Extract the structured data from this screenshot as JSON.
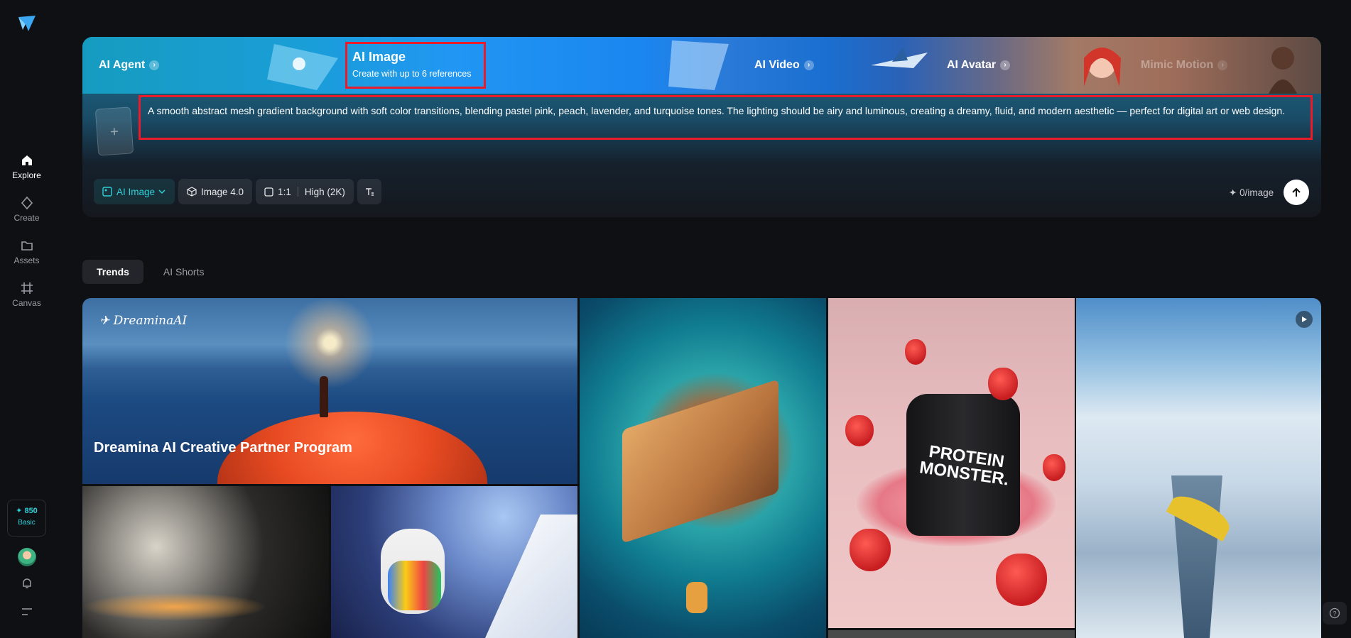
{
  "sidebar": {
    "items": [
      {
        "label": "Explore",
        "icon": "home-icon"
      },
      {
        "label": "Create",
        "icon": "diamond-icon"
      },
      {
        "label": "Assets",
        "icon": "folder-icon"
      },
      {
        "label": "Canvas",
        "icon": "canvas-icon"
      }
    ],
    "credits": {
      "value": "✦ 850",
      "plan": "Basic"
    }
  },
  "hero": {
    "tabs": [
      {
        "label": "AI Agent"
      },
      {
        "label": "AI Image",
        "subtitle": "Create with up to 6 references"
      },
      {
        "label": "AI Video"
      },
      {
        "label": "AI Avatar"
      },
      {
        "label": "Mimic Motion"
      }
    ],
    "ref_add": "+",
    "prompt": "A smooth abstract mesh gradient background with soft color transitions, blending pastel pink, peach, lavender, and turquoise tones. The lighting should be airy and luminous, creating a dreamy, fluid, and modern aesthetic — perfect for digital art or web design.",
    "toolbar": {
      "mode": "AI Image",
      "model": "Image 4.0",
      "ratio": "1:1",
      "quality": "High (2K)"
    },
    "cost": "0/image"
  },
  "section_tabs": [
    {
      "label": "Trends",
      "active": true
    },
    {
      "label": "AI Shorts",
      "active": false
    }
  ],
  "gallery": {
    "banner_brand": "DreaminaAI",
    "banner_title": "Dreamina AI Creative Partner Program",
    "jar_text": "PROTEIN MONSTER."
  },
  "colors": {
    "accent": "#2fd0d8",
    "highlight": "#e81c2a",
    "background": "#0f1014"
  }
}
